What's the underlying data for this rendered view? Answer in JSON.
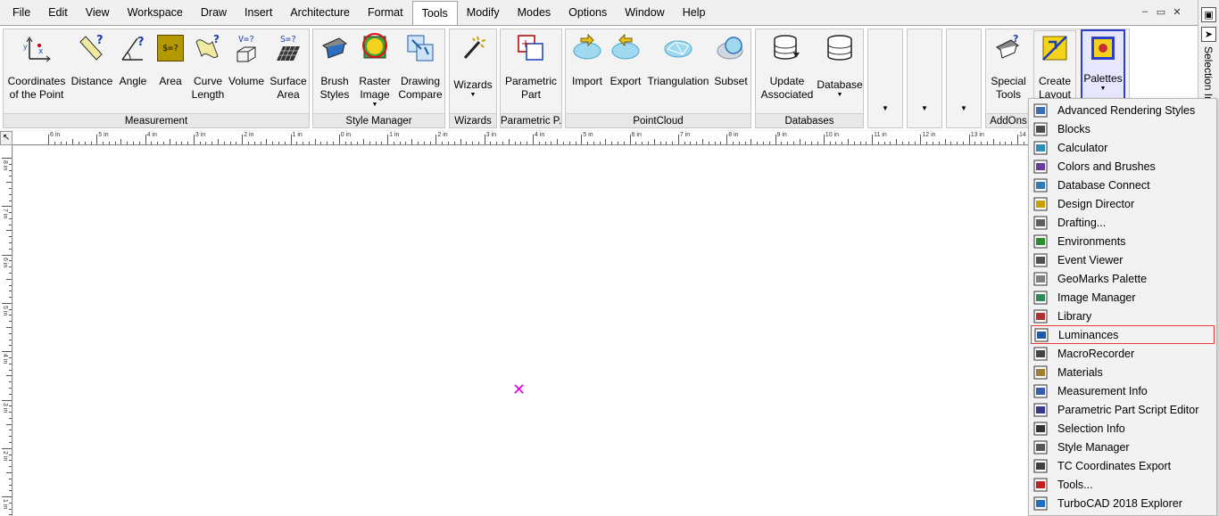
{
  "menubar": {
    "items": [
      "File",
      "Edit",
      "View",
      "Workspace",
      "Draw",
      "Insert",
      "Architecture",
      "Format",
      "Tools",
      "Modify",
      "Modes",
      "Options",
      "Window",
      "Help"
    ],
    "active": "Tools",
    "mdi": [
      "–",
      "▭",
      "✕"
    ]
  },
  "ribbon": {
    "measurement": {
      "label": "Measurement",
      "buttons": [
        "Coordinates\nof the Point",
        "Distance",
        "Angle",
        "Area",
        "Curve\nLength",
        "Volume",
        "Surface\nArea"
      ]
    },
    "style_manager": {
      "label": "Style Manager",
      "buttons": [
        "Brush\nStyles",
        "Raster\nImage",
        "Drawing\nCompare"
      ]
    },
    "wizards": {
      "label": "Wizards",
      "buttons": [
        "Wizards"
      ]
    },
    "parametric": {
      "label": "Parametric P...",
      "buttons": [
        "Parametric\nPart"
      ]
    },
    "pointcloud": {
      "label": "PointCloud",
      "buttons": [
        "Import",
        "Export",
        "Triangulation",
        "Subset"
      ]
    },
    "databases": {
      "label": "Databases",
      "buttons": [
        "Update\nAssociated",
        "Database"
      ]
    },
    "addons": {
      "label": "AddOns",
      "buttons": [
        "Special\nTools",
        "Create\nLayout",
        "Palettes"
      ]
    },
    "area_icon_text": "$=?",
    "volume_icon_text": "V=?",
    "surface_icon_text": "S=?"
  },
  "side_panel": {
    "label": "Selection Info"
  },
  "rulers": {
    "horizontal": [
      "6 in",
      "5 in",
      "4 in",
      "3 in",
      "2 in",
      "1 in",
      "0 in",
      "1 in",
      "2 in",
      "3 in",
      "4 in",
      "5 in",
      "6 in",
      "7 in",
      "8 in",
      "9 in",
      "10 in",
      "11 in",
      "12 in",
      "13 in",
      "14 in"
    ],
    "vertical": [
      "8 in",
      "7 in",
      "6 in",
      "5 in",
      "4 in",
      "3 in",
      "2 in",
      "1 in"
    ]
  },
  "palettes_menu": {
    "items": [
      {
        "label": "Advanced Rendering Styles",
        "icon": "rendering-styles-icon",
        "color": "#3c6fb0"
      },
      {
        "label": "Blocks",
        "icon": "blocks-icon",
        "color": "#4a4a4a"
      },
      {
        "label": "Calculator",
        "icon": "calculator-icon",
        "color": "#2f8fb3"
      },
      {
        "label": "Colors and Brushes",
        "icon": "colors-brushes-icon",
        "color": "#6a3a9a"
      },
      {
        "label": "Database Connect",
        "icon": "database-connect-icon",
        "color": "#2f7ab8"
      },
      {
        "label": "Design Director",
        "icon": "design-director-icon",
        "color": "#c8a000"
      },
      {
        "label": "Drafting...",
        "icon": "drafting-icon",
        "color": "#606060"
      },
      {
        "label": "Environments",
        "icon": "environments-icon",
        "color": "#2e8b2e"
      },
      {
        "label": "Event Viewer",
        "icon": "event-viewer-icon",
        "color": "#505050"
      },
      {
        "label": "GeoMarks Palette",
        "icon": "geomarks-icon",
        "color": "#808080"
      },
      {
        "label": "Image Manager",
        "icon": "image-manager-icon",
        "color": "#2e8b57"
      },
      {
        "label": "Library",
        "icon": "library-icon",
        "color": "#b03030"
      },
      {
        "label": "Luminances",
        "icon": "luminances-icon",
        "color": "#1e5aa8"
      },
      {
        "label": "MacroRecorder",
        "icon": "macro-recorder-icon",
        "color": "#444444"
      },
      {
        "label": "Materials",
        "icon": "materials-icon",
        "color": "#a08030"
      },
      {
        "label": "Measurement Info",
        "icon": "measurement-info-icon",
        "color": "#3a5ab0"
      },
      {
        "label": "Parametric Part Script Editor",
        "icon": "script-editor-icon",
        "color": "#3a3a8a"
      },
      {
        "label": "Selection Info",
        "icon": "selection-info-icon",
        "color": "#333333"
      },
      {
        "label": "Style Manager",
        "icon": "style-manager-icon",
        "color": "#555555"
      },
      {
        "label": "TC Coordinates Export",
        "icon": "coordinates-export-icon",
        "color": "#404040"
      },
      {
        "label": "Tools...",
        "icon": "tools-icon",
        "color": "#c02020"
      },
      {
        "label": "TurboCAD 2018 Explorer",
        "icon": "explorer-icon",
        "color": "#2070c0"
      }
    ],
    "highlighted": "Luminances"
  }
}
